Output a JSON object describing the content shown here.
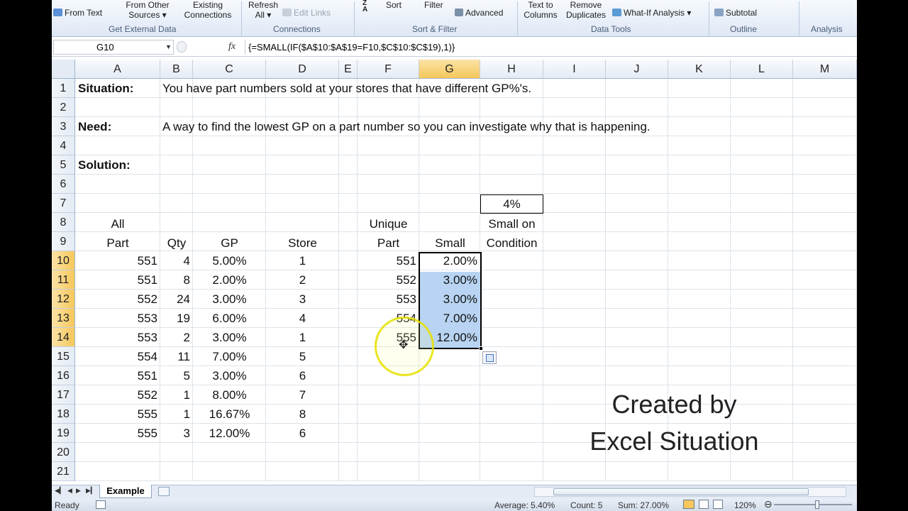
{
  "ribbon": {
    "from_text": "From Text",
    "from_other_sources_line1": "From Other",
    "from_other_sources_line2": "Sources ▾",
    "existing_connections_line1": "Existing",
    "existing_connections_line2": "Connections",
    "refresh_all_line1": "Refresh",
    "refresh_all_line2": "All ▾",
    "edit_links": "Edit Links",
    "sort": "Sort",
    "filter": "Filter",
    "advanced": "Advanced",
    "text_to_columns_line1": "Text to",
    "text_to_columns_line2": "Columns",
    "remove_duplicates_line1": "Remove",
    "remove_duplicates_line2": "Duplicates",
    "what_if_analysis": "What-If Analysis ▾",
    "subtotal": "Subtotal",
    "groups": {
      "get_external_data": "Get External Data",
      "connections": "Connections",
      "sort_filter": "Sort & Filter",
      "data_tools": "Data Tools",
      "outline": "Outline",
      "analysis": "Analysis"
    }
  },
  "formula_bar": {
    "name_box": "G10",
    "formula": "{=SMALL(IF($A$10:$A$19=F10,$C$10:$C$19),1)}"
  },
  "columns": [
    "A",
    "B",
    "C",
    "D",
    "E",
    "F",
    "G",
    "H",
    "I",
    "J",
    "K",
    "L",
    "M"
  ],
  "selected_column": "G",
  "rows": [
    "1",
    "2",
    "3",
    "4",
    "5",
    "6",
    "7",
    "8",
    "9",
    "10",
    "11",
    "12",
    "13",
    "14",
    "15",
    "16",
    "17",
    "18",
    "19",
    "20",
    "21"
  ],
  "notes": {
    "situation_label": "Situation:",
    "situation_text": "You have part numbers sold at your stores that have different GP%'s.",
    "need_label": "Need:",
    "need_text": "A way to find the lowest GP on a part number so you can investigate why that is happening.",
    "solution_label": "Solution:"
  },
  "h7_value": "4%",
  "headers": {
    "all": "All",
    "part": "Part",
    "qty": "Qty",
    "gp": "GP",
    "store": "Store",
    "unique": "Unique",
    "unique_part": "Part",
    "small": "Small",
    "small_on": "Small on",
    "condition": "Condition"
  },
  "table": [
    {
      "part": "551",
      "qty": "4",
      "gp": "5.00%",
      "store": "1"
    },
    {
      "part": "551",
      "qty": "8",
      "gp": "2.00%",
      "store": "2"
    },
    {
      "part": "552",
      "qty": "24",
      "gp": "3.00%",
      "store": "3"
    },
    {
      "part": "553",
      "qty": "19",
      "gp": "6.00%",
      "store": "4"
    },
    {
      "part": "553",
      "qty": "2",
      "gp": "3.00%",
      "store": "1"
    },
    {
      "part": "554",
      "qty": "11",
      "gp": "7.00%",
      "store": "5"
    },
    {
      "part": "551",
      "qty": "5",
      "gp": "3.00%",
      "store": "6"
    },
    {
      "part": "552",
      "qty": "1",
      "gp": "8.00%",
      "store": "7"
    },
    {
      "part": "555",
      "qty": "1",
      "gp": "16.67%",
      "store": "8"
    },
    {
      "part": "555",
      "qty": "3",
      "gp": "12.00%",
      "store": "6"
    }
  ],
  "unique_table": [
    {
      "part": "551",
      "small": "2.00%"
    },
    {
      "part": "552",
      "small": "3.00%"
    },
    {
      "part": "553",
      "small": "3.00%"
    },
    {
      "part": "554",
      "small": "7.00%"
    },
    {
      "part": "555",
      "small": "12.00%"
    }
  ],
  "watermark": {
    "line1": "Created by",
    "line2": "Excel Situation"
  },
  "sheet_tab": "Example",
  "status": {
    "mode": "Ready",
    "average": "Average: 5.40%",
    "count": "Count: 5",
    "sum": "Sum: 27.00%",
    "zoom": "120%"
  },
  "colors": {
    "selection_fill": "#b8d4f2",
    "header_selected": "#f6c75a",
    "cursor_ring": "#e6e100"
  },
  "icons": [
    "from-text-icon",
    "filter-advanced-icon",
    "what-if-icon",
    "subtotal-icon",
    "sort-az-icon",
    "fx-icon",
    "paste-options-icon",
    "cursor-move-icon",
    "new-sheet-icon",
    "page-layout-icon"
  ]
}
